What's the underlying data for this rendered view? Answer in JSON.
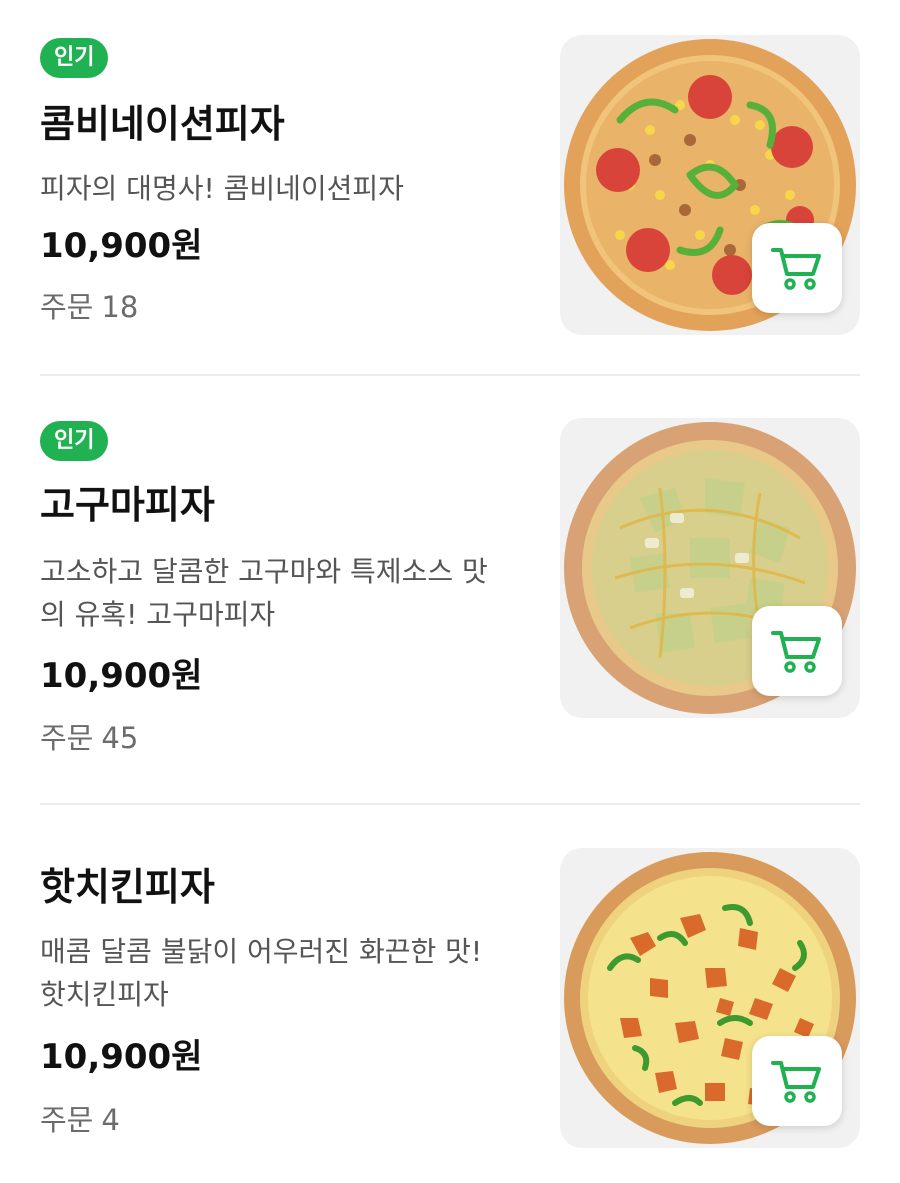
{
  "colors": {
    "badge": "#1fb152",
    "cart_icon": "#1fb152",
    "name": "#111111",
    "desc": "#555555",
    "orders": "#6b6b6b"
  },
  "items": [
    {
      "badge": "인기",
      "name": "콤비네이션피자",
      "desc": "피자의 대명사! 콤비네이션피자",
      "price": "10,900원",
      "orders_label": "주문",
      "orders_count": "18",
      "image_icon": "combination-pizza-image",
      "cart_icon": "cart-icon"
    },
    {
      "badge": "인기",
      "name": "고구마피자",
      "desc": "고소하고 달콤한 고구마와 특제소스 맛의 유혹! 고구마피자",
      "price": "10,900원",
      "orders_label": "주문",
      "orders_count": "45",
      "image_icon": "sweet-potato-pizza-image",
      "cart_icon": "cart-icon"
    },
    {
      "name": "핫치킨피자",
      "desc": "매콤 달콤 불닭이 어우러진 화끈한 맛! 핫치킨피자",
      "price": "10,900원",
      "orders_label": "주문",
      "orders_count": "4",
      "image_icon": "hot-chicken-pizza-image",
      "cart_icon": "cart-icon"
    }
  ]
}
